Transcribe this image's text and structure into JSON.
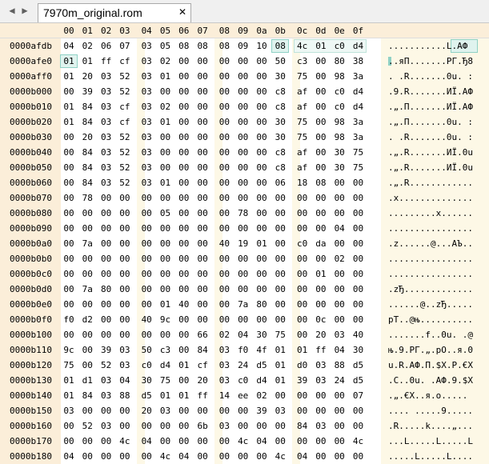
{
  "tabbar": {
    "nav_left_icon": "triangle-left-icon",
    "nav_right_icon": "triangle-right-icon",
    "tab_label": "7970m_original.rom",
    "close_glyph": "✕"
  },
  "columns": [
    "00",
    "01",
    "02",
    "03",
    "04",
    "05",
    "06",
    "07",
    "08",
    "09",
    "0a",
    "0b",
    "0c",
    "0d",
    "0e",
    "0f"
  ],
  "rows": [
    {
      "offset": "0000afdb",
      "bytes": [
        "04",
        "02",
        "06",
        "07",
        "03",
        "05",
        "08",
        "08",
        "08",
        "09",
        "10",
        "08",
        "4c",
        "01",
        "c0",
        "d4"
      ],
      "ascii": "...........L.AФ"
    },
    {
      "offset": "0000afe0",
      "bytes": [
        "01",
        "01",
        "ff",
        "cf",
        "03",
        "02",
        "00",
        "00",
        "00",
        "00",
        "00",
        "50",
        "c3",
        "00",
        "80",
        "38"
      ],
      "ascii": "..яП.......РГ.Ђ8"
    },
    {
      "offset": "0000aff0",
      "bytes": [
        "01",
        "20",
        "03",
        "52",
        "03",
        "01",
        "00",
        "00",
        "00",
        "00",
        "00",
        "30",
        "75",
        "00",
        "98",
        "3a"
      ],
      "ascii": ". .R.......0u. :"
    },
    {
      "offset": "0000b000",
      "bytes": [
        "00",
        "39",
        "03",
        "52",
        "03",
        "00",
        "00",
        "00",
        "00",
        "00",
        "00",
        "c8",
        "af",
        "00",
        "c0",
        "d4"
      ],
      "ascii": ".9.R.......ИЇ.АФ"
    },
    {
      "offset": "0000b010",
      "bytes": [
        "01",
        "84",
        "03",
        "cf",
        "03",
        "02",
        "00",
        "00",
        "00",
        "00",
        "00",
        "c8",
        "af",
        "00",
        "c0",
        "d4"
      ],
      "ascii": ".„.П.......ИЇ.АФ"
    },
    {
      "offset": "0000b020",
      "bytes": [
        "01",
        "84",
        "03",
        "cf",
        "03",
        "01",
        "00",
        "00",
        "00",
        "00",
        "00",
        "30",
        "75",
        "00",
        "98",
        "3a"
      ],
      "ascii": ".„.П.......0u. :"
    },
    {
      "offset": "0000b030",
      "bytes": [
        "00",
        "20",
        "03",
        "52",
        "03",
        "00",
        "00",
        "00",
        "00",
        "00",
        "00",
        "30",
        "75",
        "00",
        "98",
        "3a"
      ],
      "ascii": ". .R.......0u. :"
    },
    {
      "offset": "0000b040",
      "bytes": [
        "00",
        "84",
        "03",
        "52",
        "03",
        "00",
        "00",
        "00",
        "00",
        "00",
        "00",
        "c8",
        "af",
        "00",
        "30",
        "75"
      ],
      "ascii": ".„.R.......ИЇ.0u"
    },
    {
      "offset": "0000b050",
      "bytes": [
        "00",
        "84",
        "03",
        "52",
        "03",
        "00",
        "00",
        "00",
        "00",
        "00",
        "00",
        "c8",
        "af",
        "00",
        "30",
        "75"
      ],
      "ascii": ".„.R.......ИЇ.0u"
    },
    {
      "offset": "0000b060",
      "bytes": [
        "00",
        "84",
        "03",
        "52",
        "03",
        "01",
        "00",
        "00",
        "00",
        "00",
        "00",
        "06",
        "18",
        "08",
        "00",
        "00"
      ],
      "ascii": ".„.R............"
    },
    {
      "offset": "0000b070",
      "bytes": [
        "00",
        "78",
        "00",
        "00",
        "00",
        "00",
        "00",
        "00",
        "00",
        "00",
        "00",
        "00",
        "00",
        "00",
        "00",
        "00"
      ],
      "ascii": ".x.............."
    },
    {
      "offset": "0000b080",
      "bytes": [
        "00",
        "00",
        "00",
        "00",
        "00",
        "05",
        "00",
        "00",
        "00",
        "78",
        "00",
        "00",
        "00",
        "00",
        "00",
        "00"
      ],
      "ascii": ".........x......"
    },
    {
      "offset": "0000b090",
      "bytes": [
        "00",
        "00",
        "00",
        "00",
        "00",
        "00",
        "00",
        "00",
        "00",
        "00",
        "00",
        "00",
        "00",
        "00",
        "04",
        "00"
      ],
      "ascii": "................"
    },
    {
      "offset": "0000b0a0",
      "bytes": [
        "00",
        "7a",
        "00",
        "00",
        "00",
        "00",
        "00",
        "00",
        "40",
        "19",
        "01",
        "00",
        "c0",
        "da",
        "00",
        "00"
      ],
      "ascii": ".z......@...АЪ.."
    },
    {
      "offset": "0000b0b0",
      "bytes": [
        "00",
        "00",
        "00",
        "00",
        "00",
        "00",
        "00",
        "00",
        "00",
        "00",
        "00",
        "00",
        "00",
        "00",
        "02",
        "00"
      ],
      "ascii": "................"
    },
    {
      "offset": "0000b0c0",
      "bytes": [
        "00",
        "00",
        "00",
        "00",
        "00",
        "00",
        "00",
        "00",
        "00",
        "00",
        "00",
        "00",
        "00",
        "01",
        "00",
        "00"
      ],
      "ascii": "................"
    },
    {
      "offset": "0000b0d0",
      "bytes": [
        "00",
        "7a",
        "80",
        "00",
        "00",
        "00",
        "00",
        "00",
        "00",
        "00",
        "00",
        "00",
        "00",
        "00",
        "00",
        "00"
      ],
      "ascii": ".zЂ............."
    },
    {
      "offset": "0000b0e0",
      "bytes": [
        "00",
        "00",
        "00",
        "00",
        "00",
        "01",
        "40",
        "00",
        "00",
        "7a",
        "80",
        "00",
        "00",
        "00",
        "00",
        "00"
      ],
      "ascii": "......@..zЂ....."
    },
    {
      "offset": "0000b0f0",
      "bytes": [
        "f0",
        "d2",
        "00",
        "00",
        "40",
        "9c",
        "00",
        "00",
        "00",
        "00",
        "00",
        "00",
        "00",
        "0c",
        "00",
        "00"
      ],
      "ascii": "рТ..@њ.........."
    },
    {
      "offset": "0000b100",
      "bytes": [
        "00",
        "00",
        "00",
        "00",
        "00",
        "00",
        "00",
        "66",
        "02",
        "04",
        "30",
        "75",
        "00",
        "20",
        "03",
        "40"
      ],
      "ascii": ".......f..0u. .@"
    },
    {
      "offset": "0000b110",
      "bytes": [
        "9c",
        "00",
        "39",
        "03",
        "50",
        "c3",
        "00",
        "84",
        "03",
        "f0",
        "4f",
        "01",
        "01",
        "ff",
        "04",
        "30"
      ],
      "ascii": "њ.9.РГ.„.рO..я.0"
    },
    {
      "offset": "0000b120",
      "bytes": [
        "75",
        "00",
        "52",
        "03",
        "c0",
        "d4",
        "01",
        "cf",
        "03",
        "24",
        "d5",
        "01",
        "d0",
        "03",
        "88",
        "d5"
      ],
      "ascii": "u.R.АФ.П.$Х.Р.€Х"
    },
    {
      "offset": "0000b130",
      "bytes": [
        "01",
        "d1",
        "03",
        "04",
        "30",
        "75",
        "00",
        "20",
        "03",
        "c0",
        "d4",
        "01",
        "39",
        "03",
        "24",
        "d5"
      ],
      "ascii": ".С..0u. .АФ.9.$Х"
    },
    {
      "offset": "0000b140",
      "bytes": [
        "01",
        "84",
        "03",
        "88",
        "d5",
        "01",
        "01",
        "ff",
        "14",
        "ee",
        "02",
        "00",
        "00",
        "00",
        "00",
        "07"
      ],
      "ascii": ".„.€Х..я.о....."
    },
    {
      "offset": "0000b150",
      "bytes": [
        "03",
        "00",
        "00",
        "00",
        "20",
        "03",
        "00",
        "00",
        "00",
        "00",
        "39",
        "03",
        "00",
        "00",
        "00",
        "00"
      ],
      "ascii": ".... .....9....."
    },
    {
      "offset": "0000b160",
      "bytes": [
        "00",
        "52",
        "03",
        "00",
        "00",
        "00",
        "00",
        "6b",
        "03",
        "00",
        "00",
        "00",
        "84",
        "03",
        "00",
        "00"
      ],
      "ascii": ".R.....k....„..."
    },
    {
      "offset": "0000b170",
      "bytes": [
        "00",
        "00",
        "00",
        "4c",
        "04",
        "00",
        "00",
        "00",
        "00",
        "4c",
        "04",
        "00",
        "00",
        "00",
        "00",
        "4c"
      ],
      "ascii": "...L.....L.....L"
    },
    {
      "offset": "0000b180",
      "bytes": [
        "04",
        "00",
        "00",
        "00",
        "00",
        "4c",
        "04",
        "00",
        "00",
        "00",
        "00",
        "4c",
        "04",
        "00",
        "00",
        "00"
      ],
      "ascii": ".....L.....L...."
    }
  ]
}
